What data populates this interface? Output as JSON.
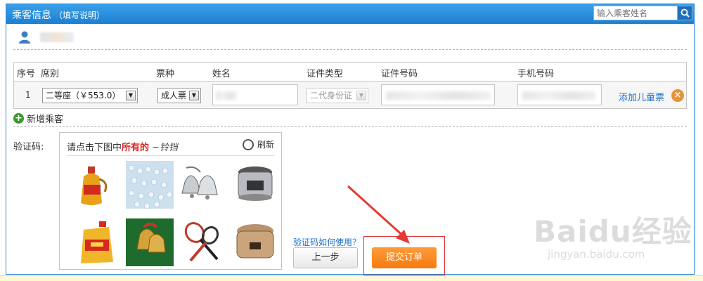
{
  "panel": {
    "title": "乘客信息",
    "title_note": "（填写说明）",
    "search": {
      "placeholder": "输入乘客姓名"
    }
  },
  "table": {
    "headers": [
      "序号",
      "席别",
      "票种",
      "姓名",
      "证件类型",
      "证件号码",
      "手机号码"
    ],
    "row": {
      "index": "1",
      "seat": "二等座（￥553.0）",
      "ticket_type": "成人票",
      "id_type": "二代身份证",
      "add_child_label": "添加儿童票"
    }
  },
  "add_passenger_label": "新增乘客",
  "captcha": {
    "label": "验证码:",
    "prompt_prefix": "请点击下图中",
    "prompt_emphasis": "所有的",
    "prompt_word": "~铃铛",
    "refresh_label": "刷新",
    "tiles": [
      "cooking-oil-bottle",
      "bead-necklace",
      "silver-bells",
      "pressure-cooker",
      "oil-jug",
      "christmas-bells",
      "tennis-rackets",
      "rice-cooker"
    ],
    "help_link": "验证码如何使用？"
  },
  "buttons": {
    "prev": "上一步",
    "submit": "提交订单"
  },
  "watermark": {
    "brand": "Baidu经验",
    "url": "jingyan.baidu.com"
  },
  "colors": {
    "header_blue": "#2d8ad6",
    "submit_orange": "#f57a10",
    "highlight_red": "#e03030",
    "link_blue": "#1f6fc6"
  }
}
